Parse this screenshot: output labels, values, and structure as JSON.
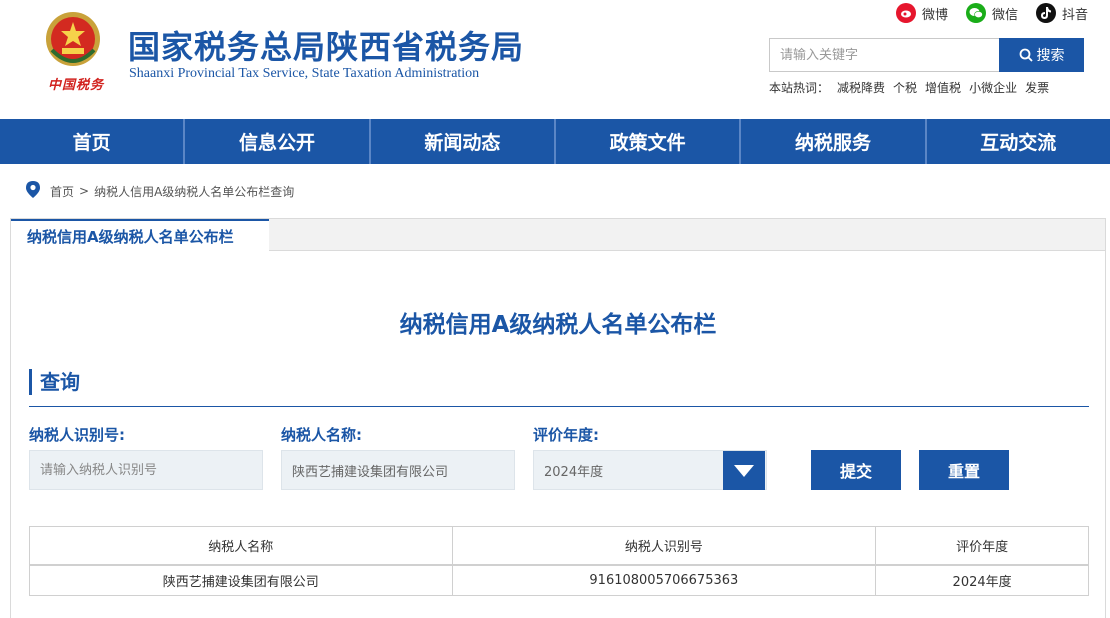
{
  "header": {
    "title": "国家税务总局陕西省税务局",
    "title_en": "Shaanxi Provincial Tax Service, State Taxation Administration",
    "logo_sub": "中国税务"
  },
  "social": [
    {
      "label": "微博",
      "icon": "weibo-icon",
      "color": "#e6162d"
    },
    {
      "label": "微信",
      "icon": "wechat-icon",
      "color": "#1aad19"
    },
    {
      "label": "抖音",
      "icon": "douyin-icon",
      "color": "#111111"
    }
  ],
  "search": {
    "placeholder": "请输入关键字",
    "button_label": "搜索",
    "hot_label": "本站热词：",
    "hot_words": [
      "减税降费",
      "个税",
      "增值税",
      "小微企业",
      "发票"
    ]
  },
  "nav": [
    "首页",
    "信息公开",
    "新闻动态",
    "政策文件",
    "纳税服务",
    "互动交流"
  ],
  "breadcrumb": {
    "home": "首页",
    "separator": ">",
    "current": "纳税人信用A级纳税人名单公布栏查询"
  },
  "panel": {
    "tab_label": "纳税信用A级纳税人名单公布栏",
    "heading": "纳税信用A级纳税人名单公布栏",
    "section_title": "查询"
  },
  "form": {
    "id_label": "纳税人识别号:",
    "id_placeholder": "请输入纳税人识别号",
    "name_label": "纳税人名称:",
    "name_value": "陕西艺捕建设集团有限公司",
    "year_label": "评价年度:",
    "year_value": "2024年度",
    "submit_label": "提交",
    "reset_label": "重置"
  },
  "table": {
    "headers": [
      "纳税人名称",
      "纳税人识别号",
      "评价年度"
    ],
    "rows": [
      [
        "陕西艺捕建设集团有限公司",
        "916108005706675363",
        "2024年度"
      ]
    ]
  },
  "colors": {
    "brand": "#1b56a6",
    "field_bg": "#ecf1f5"
  }
}
